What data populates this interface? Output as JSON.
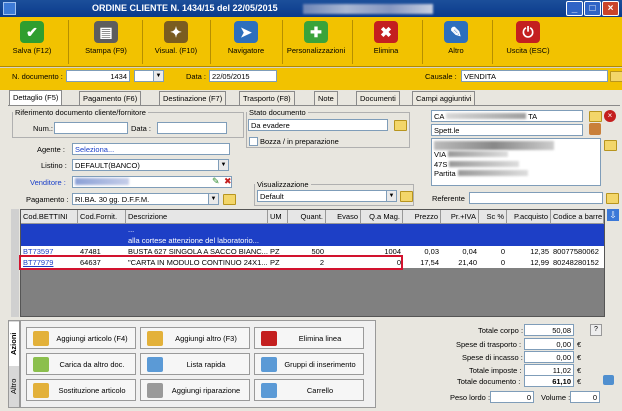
{
  "window": {
    "title": "ORDINE CLIENTE N. 1434/15 del 22/05/2015"
  },
  "toolbar": [
    {
      "label": "Salva (F12)",
      "icon": "check-icon",
      "color": "#2f9e2f"
    },
    {
      "label": "Stampa (F9)",
      "icon": "printer-icon",
      "color": "#5d5d5d"
    },
    {
      "label": "Visual. (F10)",
      "icon": "wand-icon",
      "color": "#7a5c20"
    },
    {
      "label": "Navigatore",
      "icon": "compass-icon",
      "color": "#2d6fbd"
    },
    {
      "label": "Personalizzazioni",
      "icon": "puzzle-icon",
      "color": "#3aa33a"
    },
    {
      "label": "Elimina",
      "icon": "delete-x-icon",
      "color": "#c41f1f"
    },
    {
      "label": "Altro",
      "icon": "other-icon",
      "color": "#2d6fbd"
    },
    {
      "label": "Uscita (ESC)",
      "icon": "exit-icon",
      "color": "#c41f1f"
    }
  ],
  "header": {
    "ndoc_label": "N. documento :",
    "ndoc_value": "1434",
    "data_label": "Data :",
    "data_value": "22/05/2015",
    "causale_label": "Causale :",
    "causale_value": "VENDITA"
  },
  "tabs": [
    "Dettaglio (F5)",
    "Pagamento (F6)",
    "Destinazione (F7)",
    "Trasporto (F8)",
    "Note",
    "Documenti",
    "Campi aggiuntivi"
  ],
  "rif": {
    "legend": "Riferimento documento cliente/fornitore",
    "num_label": "Num.:",
    "data_label": "Data :"
  },
  "stato": {
    "legend": "Stato documento",
    "value": "Da evadere",
    "bozza_label": "Bozza / in preparazione"
  },
  "form": {
    "agente_label": "Agente :",
    "agente_value": "Seleziona...",
    "listino_label": "Listino :",
    "listino_value": "DEFAULT(BANCO)",
    "venditore_label": "Venditore :",
    "pagamento_label": "Pagamento :",
    "pagamento_value": "RI.BA. 30 gg. D.F.F.M."
  },
  "visualizzazione": {
    "legend": "Visualizzazione",
    "value": "Default"
  },
  "cliente": {
    "spett": "Spett.le",
    "line1": "CA",
    "line1b": "TA",
    "line2": "",
    "line3": "VIA",
    "line4": "47S",
    "line5": "Partita"
  },
  "referente_label": "Referente",
  "grid": {
    "headers": [
      "Cod.BETTINI",
      "Cod.Fornit.",
      "Descrizione",
      "UM",
      "Quant.",
      "Evaso",
      "Q.a Mag.",
      "Prezzo",
      "Pr.+IVA",
      "Sc %",
      "P.acquisto",
      "Codice a barre"
    ],
    "rows": [
      {
        "cells": [
          "",
          "",
          "...",
          "",
          "",
          "",
          "",
          "",
          "",
          "",
          "",
          ""
        ]
      },
      {
        "cells": [
          "",
          "",
          "alla cortese attenzione del laboratorio...",
          "",
          "",
          "",
          "",
          "",
          "",
          "",
          "",
          ""
        ]
      },
      {
        "cells": [
          "BT73597",
          "47481",
          "BUSTA 627 SINGOLA A SACCO BIANC...",
          "PZ",
          "500",
          "",
          "1004",
          "0,03",
          "0,04",
          "0",
          "12,35",
          "80077580062"
        ]
      },
      {
        "cells": [
          "BT77979",
          "64637",
          "\"CARTA IN MODULO CONTINUO 24X1...",
          "PZ",
          "2",
          "",
          "0",
          "17,54",
          "21,40",
          "0",
          "12,99",
          "80248280152"
        ]
      }
    ]
  },
  "side_tabs": [
    "Azioni",
    "Altro"
  ],
  "actions": [
    {
      "label": "Aggiungi articolo (F4)",
      "icon": "add-article-icon"
    },
    {
      "label": "Aggiungi altro (F3)",
      "icon": "add-other-icon"
    },
    {
      "label": "Elimina linea",
      "icon": "delete-line-icon"
    },
    {
      "label": "Carica da altro doc.",
      "icon": "load-doc-icon"
    },
    {
      "label": "Lista rapida",
      "icon": "quick-list-icon"
    },
    {
      "label": "Gruppi di inserimento",
      "icon": "groups-icon"
    },
    {
      "label": "Sostituzione articolo",
      "icon": "replace-icon"
    },
    {
      "label": "Aggiungi riparazione",
      "icon": "repair-icon"
    },
    {
      "label": "Carrello",
      "icon": "cart-icon"
    }
  ],
  "totals": [
    {
      "label": "Totale corpo :",
      "value": "50,08"
    },
    {
      "label": "Spese di trasporto :",
      "value": "0,00"
    },
    {
      "label": "Spese di incasso :",
      "value": "0,00"
    },
    {
      "label": "Totale imposte :",
      "value": "11,02"
    },
    {
      "label": "Totale documento :",
      "value": "61,10"
    }
  ],
  "weights": {
    "lordo_label": "Peso lordo :",
    "lordo_value": "0",
    "volume_label": "Volume :",
    "volume_value": "0"
  },
  "currency": "€"
}
